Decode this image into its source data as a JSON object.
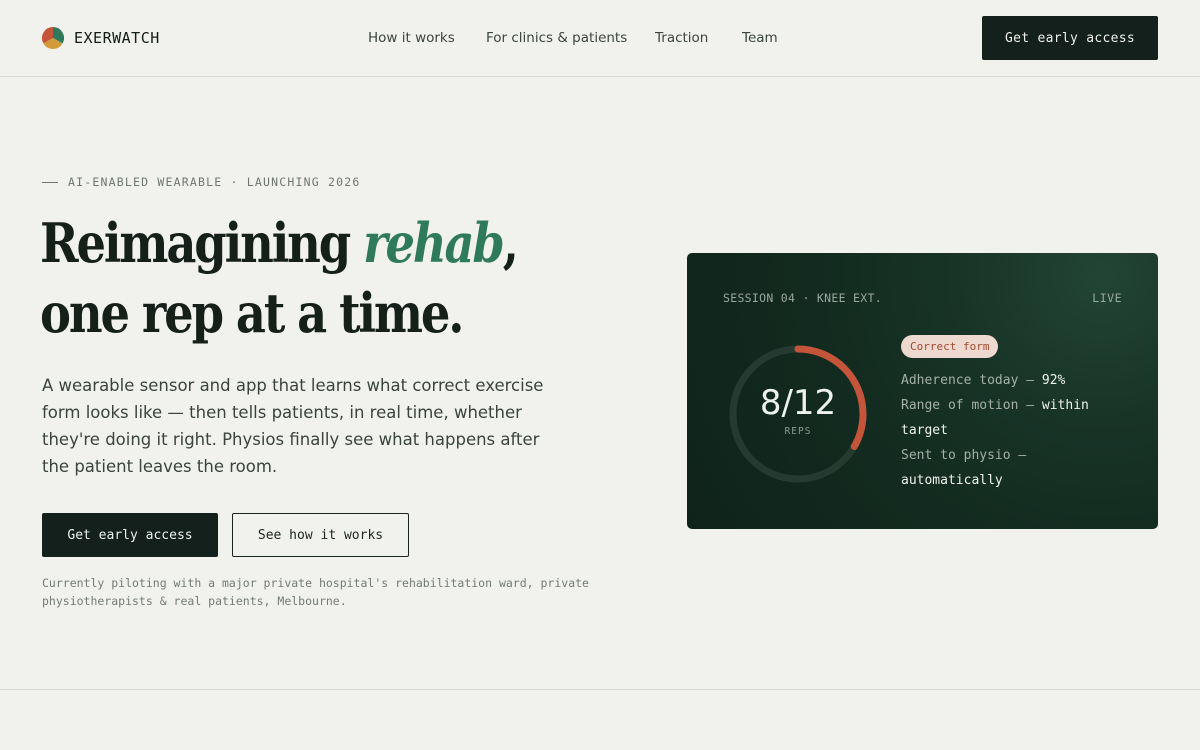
{
  "brand": {
    "name": "EXERWATCH"
  },
  "nav": {
    "links": [
      "How it works",
      "For clinics & patients",
      "Traction",
      "Team"
    ],
    "cta": "Get early access"
  },
  "hero": {
    "eyebrow": "AI-ENABLED WEARABLE · LAUNCHING 2026",
    "headline_pre": "Reimagining ",
    "headline_accent": "rehab",
    "headline_post": ", one rep at a time.",
    "lead": "A wearable sensor and app that learns what correct exercise form looks like — then tells patients, in real time, whether they're doing it right. Physios finally see what happens after the patient leaves the room.",
    "primary_cta": "Get early access",
    "secondary_cta": "See how it works",
    "pilot_note": "Currently piloting with a major private hospital's rehabilitation ward, private physiotherapists & real patients, Melbourne."
  },
  "card": {
    "session": "SESSION 04 · KNEE EXT.",
    "live": "LIVE",
    "reps_done": 8,
    "reps_total": 12,
    "reps_text": "8/12",
    "reps_label": "REPS",
    "badge": "Correct form",
    "stats": [
      {
        "label": "Adherence today — ",
        "value": "92%"
      },
      {
        "label": "Range of motion — ",
        "value": "within target"
      },
      {
        "label": "Sent to physio — ",
        "value": "automatically"
      }
    ]
  },
  "colors": {
    "accent_green": "#2f7a5a",
    "ring_progress": "#c4553a",
    "card_bg": "#132b20",
    "cta_bg": "#14201b"
  },
  "icons": {
    "logo": "exerwatch-logo-icon"
  }
}
